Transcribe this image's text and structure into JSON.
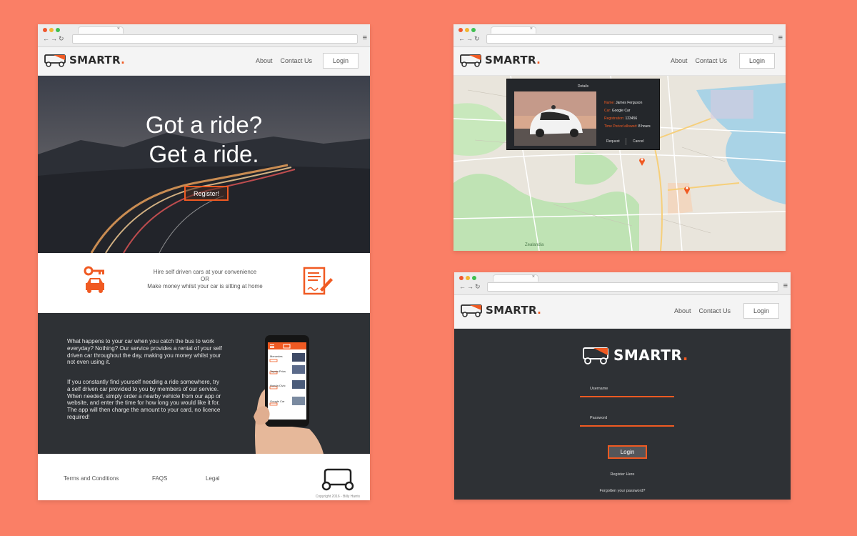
{
  "colors": {
    "background": "#fa7f66",
    "accent": "#f05a22",
    "dark": "#2e3135"
  },
  "brand": {
    "name": "SMARTR",
    "dot": "."
  },
  "nav": {
    "about": "About",
    "contact": "Contact Us",
    "login": "Login"
  },
  "home": {
    "hero_line1": "Got a ride?",
    "hero_line2": "Get a ride.",
    "cta": "Register!",
    "feature_line1": "Hire self driven cars at your convenience",
    "feature_or": "OR",
    "feature_line2": "Make money whilst your car is sitting at home",
    "paragraph1": "What happens to your car when you catch the bus to work everyday? Nothing? Our service provides a rental of your self driven car throughout the day, making you money whilst your not even using it.",
    "paragraph2": "If you constantly find yourself needing a ride somewhere, try a self driven car provided to you by members of our service. When needed, simply order a nearby vehicle from our app or website, and enter the time for how long you would like it for. The app will then charge the amount to your card, no licence required!",
    "phone_items": [
      "Mercedes",
      "Toyota Prius",
      "Honda Civic",
      "Google Car"
    ],
    "footer": {
      "terms": "Terms and Conditions",
      "faqs": "FAQS",
      "legal": "Legal",
      "copyright": "Copyright 2016 - Billy Harris"
    }
  },
  "map": {
    "details_title": "Details",
    "name_label": "Name:",
    "name": "James Ferguson",
    "car_label": "Car:",
    "car": "Google Car",
    "reg_label": "Registration:",
    "reg": "123456",
    "time_label": "Time Period allowed:",
    "time": "8 hours",
    "request": "Request",
    "cancel": "Cancel",
    "place_label": "Zealandia"
  },
  "login": {
    "username": "Username",
    "password": "Password",
    "submit": "Login",
    "register": "Register Here",
    "forgot": "Forgotten your password?"
  }
}
